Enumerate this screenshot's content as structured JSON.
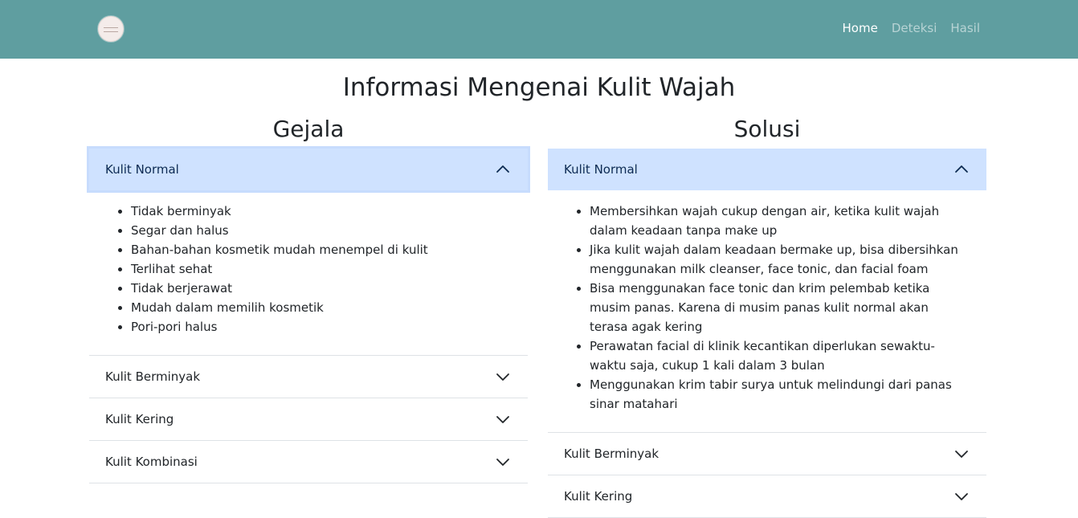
{
  "nav": {
    "items": [
      {
        "label": "Home",
        "active": true
      },
      {
        "label": "Deteksi",
        "active": false
      },
      {
        "label": "Hasil",
        "active": false
      }
    ]
  },
  "page": {
    "title": "Informasi Mengenai Kulit Wajah"
  },
  "gejala": {
    "title": "Gejala",
    "items": [
      {
        "label": "Kulit Normal",
        "open": true,
        "details": [
          "Tidak berminyak",
          "Segar dan halus",
          "Bahan-bahan kosmetik mudah menempel di kulit",
          "Terlihat sehat",
          "Tidak berjerawat",
          "Mudah dalam memilih kosmetik",
          "Pori-pori halus"
        ]
      },
      {
        "label": "Kulit Berminyak",
        "open": false
      },
      {
        "label": "Kulit Kering",
        "open": false
      },
      {
        "label": "Kulit Kombinasi",
        "open": false
      }
    ]
  },
  "solusi": {
    "title": "Solusi",
    "items": [
      {
        "label": "Kulit Normal",
        "open": true,
        "details": [
          "Membersihkan wajah cukup dengan air, ketika kulit wajah dalam keadaan tanpa make up",
          "Jika kulit wajah dalam keadaan bermake up, bisa dibersihkan menggunakan milk cleanser, face tonic, dan facial foam",
          "Bisa menggunakan face tonic dan krim pelembab ketika musim panas. Karena di musim panas kulit normal akan terasa agak kering",
          "Perawatan facial di klinik kecantikan diperlukan sewaktu-waktu saja, cukup 1 kali dalam 3 bulan",
          "Menggunakan krim tabir surya untuk melindungi dari panas sinar matahari"
        ]
      },
      {
        "label": "Kulit Berminyak",
        "open": false
      },
      {
        "label": "Kulit Kering",
        "open": false
      }
    ]
  },
  "icons": {
    "chevron_up": "chevron-up-icon",
    "chevron_down": "chevron-down-icon"
  }
}
